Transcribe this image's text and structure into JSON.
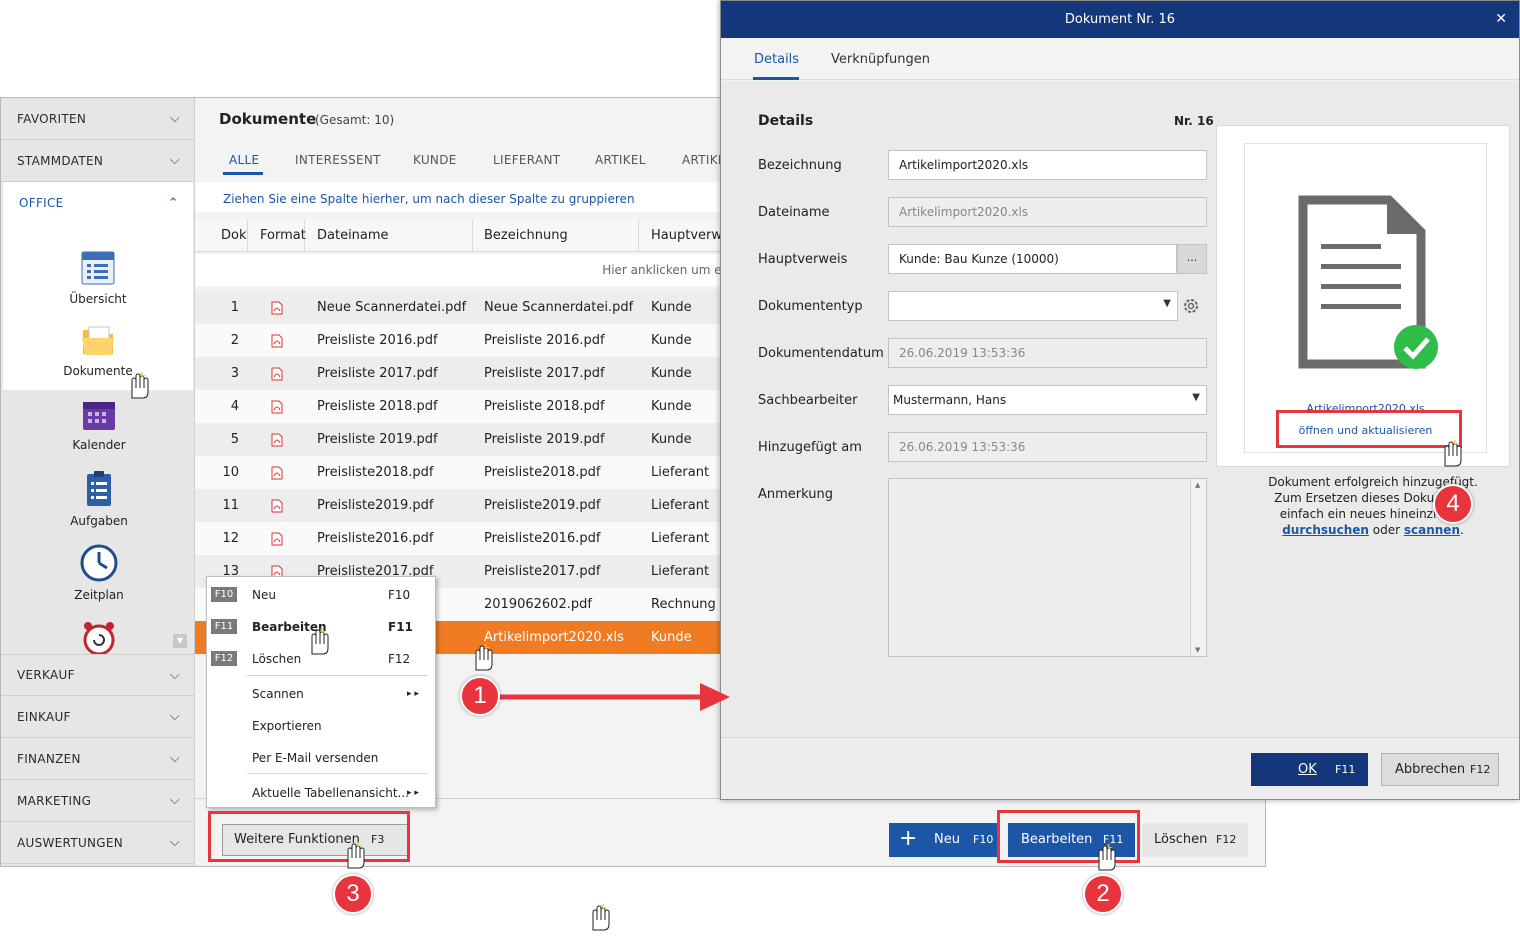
{
  "sidebar": {
    "sections_top": [
      "FAVORITEN",
      "STAMMDATEN"
    ],
    "office": {
      "label": "OFFICE"
    },
    "tiles": [
      {
        "label": "Übersicht",
        "icon": "overview-icon"
      },
      {
        "label": "Dokumente",
        "icon": "documents-folder-icon"
      },
      {
        "label": "Kalender",
        "icon": "calendar-icon"
      },
      {
        "label": "Aufgaben",
        "icon": "tasks-icon"
      },
      {
        "label": "Zeitplan",
        "icon": "clock-icon"
      }
    ],
    "sections_bottom": [
      "VERKAUF",
      "EINKAUF",
      "FINANZEN",
      "MARKETING",
      "AUSWERTUNGEN"
    ]
  },
  "main": {
    "title": "Dokumente",
    "count": "(Gesamt: 10)",
    "tabs": [
      "ALLE",
      "INTERESSENT",
      "KUNDE",
      "LIEFERANT",
      "ARTIKEL",
      "ARTIKE"
    ],
    "group_hint": "Ziehen Sie eine Spalte hierher, um nach dieser Spalte zu gruppieren",
    "columns": [
      "Dok",
      "Format",
      "Dateiname",
      "Bezeichnung",
      "Hauptverwe"
    ],
    "click_hint": "Hier anklicken um ei",
    "rows": [
      {
        "nr": "1",
        "file": "Neue Scannerdatei.pdf",
        "desc": "Neue Scannerdatei.pdf",
        "ref": "Kunde"
      },
      {
        "nr": "2",
        "file": "Preisliste 2016.pdf",
        "desc": "Preisliste 2016.pdf",
        "ref": "Kunde"
      },
      {
        "nr": "3",
        "file": "Preisliste 2017.pdf",
        "desc": "Preisliste 2017.pdf",
        "ref": "Kunde"
      },
      {
        "nr": "4",
        "file": "Preisliste 2018.pdf",
        "desc": "Preisliste 2018.pdf",
        "ref": "Kunde"
      },
      {
        "nr": "5",
        "file": "Preisliste 2019.pdf",
        "desc": "Preisliste 2019.pdf",
        "ref": "Kunde"
      },
      {
        "nr": "10",
        "file": "Preisliste2018.pdf",
        "desc": "Preisliste2018.pdf",
        "ref": "Lieferant"
      },
      {
        "nr": "11",
        "file": "Preisliste2019.pdf",
        "desc": "Preisliste2019.pdf",
        "ref": "Lieferant"
      },
      {
        "nr": "12",
        "file": "Preisliste2016.pdf",
        "desc": "Preisliste2016.pdf",
        "ref": "Lieferant"
      },
      {
        "nr": "13",
        "file": "Preisliste2017.pdf",
        "desc": "Preisliste2017.pdf",
        "ref": "Lieferant"
      },
      {
        "nr": "",
        "file": "",
        "desc": "2019062602.pdf",
        "ref": "Rechnung"
      },
      {
        "nr": "",
        "file": "",
        "desc": "Artikelimport2020.xls",
        "ref": "Kunde"
      }
    ]
  },
  "footer": {
    "more": {
      "label": "Weitere Funktionen",
      "key": "F3"
    },
    "new": {
      "label": "Neu",
      "key": "F10"
    },
    "edit": {
      "label": "Bearbeiten",
      "key": "F11"
    },
    "delete": {
      "label": "Löschen",
      "key": "F12"
    }
  },
  "context_menu": {
    "items": [
      {
        "badge": "F10",
        "label": "Neu",
        "key": "F10"
      },
      {
        "badge": "F11",
        "label": "Bearbeiten",
        "key": "F11"
      },
      {
        "badge": "F12",
        "label": "Löschen",
        "key": "F12"
      },
      {
        "badge": "",
        "label": "Scannen",
        "key": ""
      },
      {
        "badge": "",
        "label": "Exportieren",
        "key": ""
      },
      {
        "badge": "",
        "label": "Per E-Mail versenden",
        "key": ""
      },
      {
        "badge": "",
        "label": "Aktuelle Tabellenansicht...",
        "key": ""
      }
    ]
  },
  "dialog": {
    "title": "Dokument Nr. 16",
    "close": "✕",
    "tabs": [
      "Details",
      "Verknüpfungen"
    ],
    "section": "Details",
    "nr": "Nr. 16",
    "fields": [
      {
        "label": "Bezeichnung",
        "value": "Artikelimport2020.xls"
      },
      {
        "label": "Dateiname",
        "value": "Artikelimport2020.xls"
      },
      {
        "label": "Hauptverweis",
        "value": "Kunde: Bau Kunze (10000)"
      },
      {
        "label": "Dokumententyp",
        "value": ""
      },
      {
        "label": "Dokumentendatum",
        "value": "26.06.2019 13:53:36"
      },
      {
        "label": "Sachbearbeiter",
        "value": "Mustermann, Hans"
      },
      {
        "label": "Hinzugefügt am",
        "value": "26.06.2019 13:53:36"
      },
      {
        "label": "Anmerkung",
        "value": ""
      }
    ],
    "lookup_btn": "...",
    "preview": {
      "filename": "Artikelimport2020.xls",
      "action": "öffnen und aktualisieren",
      "msg_line1": "Dokument erfolgreich hinzugefügt.",
      "msg_line2": "Zum Ersetzen dieses Dokuments",
      "msg_line3": "einfach ein neues hineinziehen",
      "link_browse": "durchsuchen",
      "word_or": "oder",
      "link_scan": "scannen",
      "period": "."
    },
    "ok": {
      "label": "OK",
      "key": "F11"
    },
    "cancel": {
      "label": "Abbrechen",
      "key": "F12"
    }
  },
  "annotations": [
    "1",
    "2",
    "3",
    "4"
  ],
  "colors": {
    "accent": "#1c56a7",
    "title_bar": "#13377a",
    "selection": "#f07b23",
    "annotation": "#e8343c",
    "success": "#2ebd48"
  }
}
